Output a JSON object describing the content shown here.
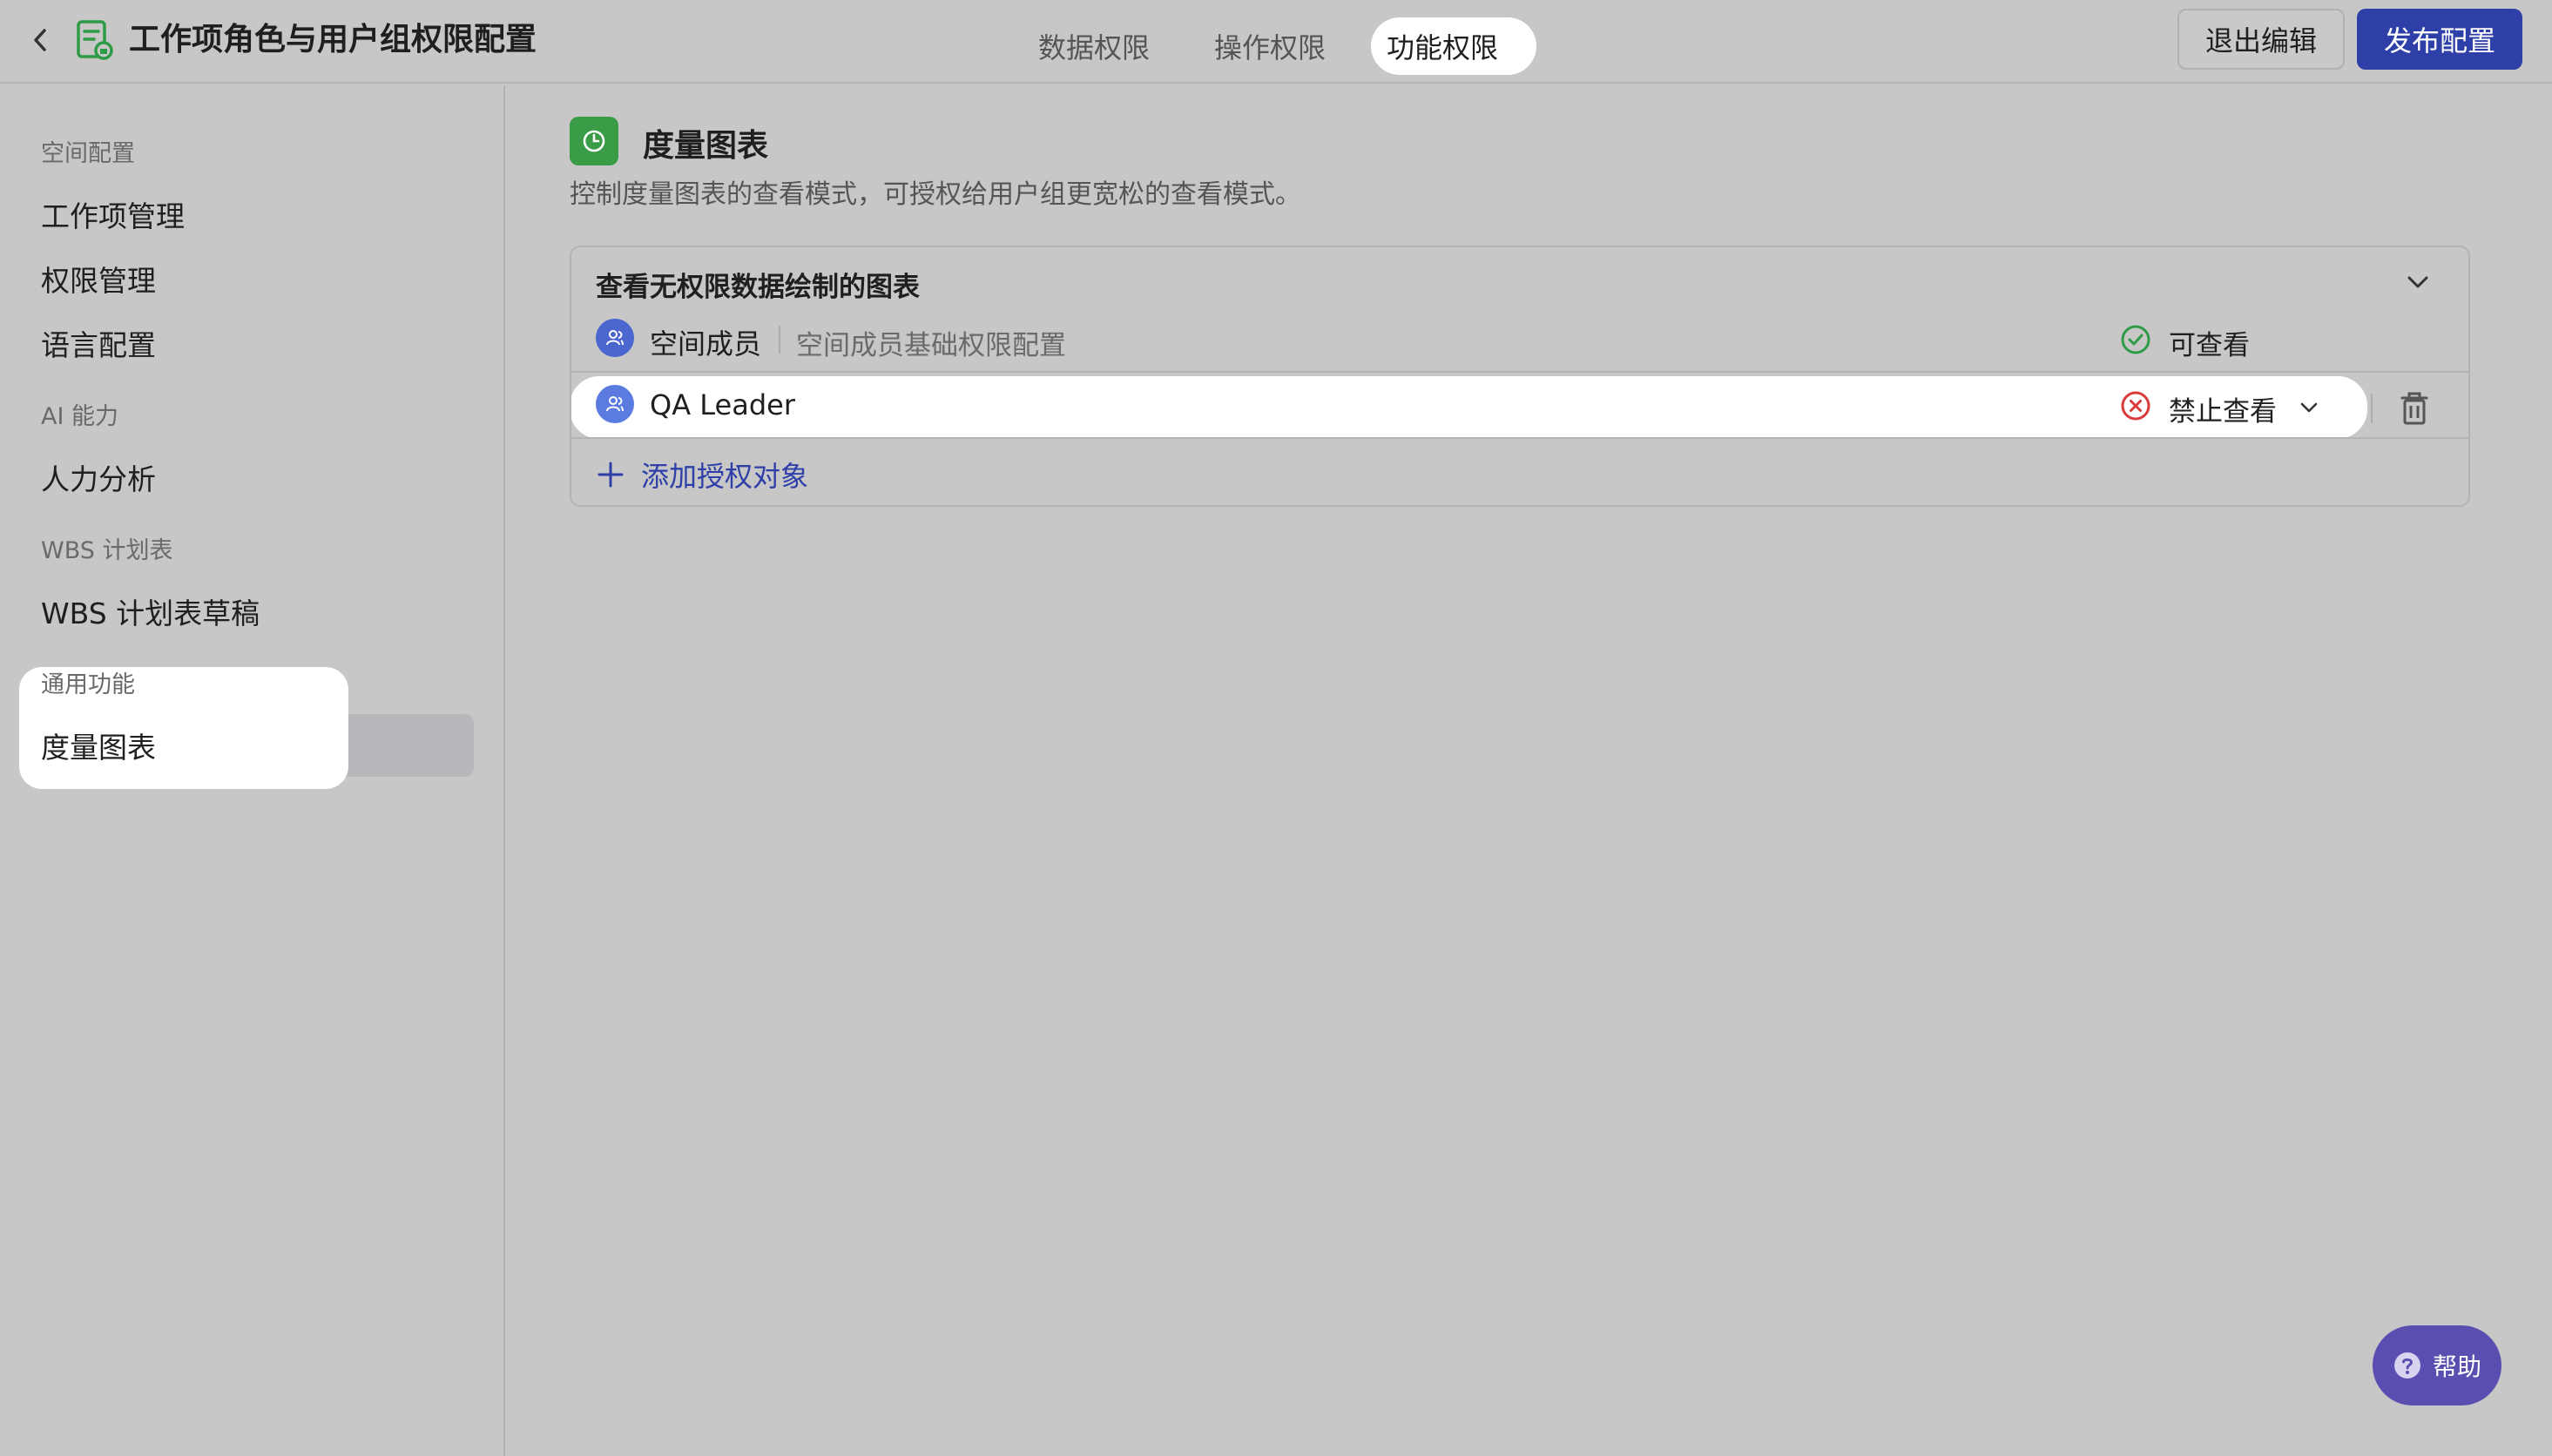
{
  "header": {
    "title": "工作项角色与用户组权限配置",
    "tabs": [
      {
        "label": "数据权限",
        "active": false
      },
      {
        "label": "操作权限",
        "active": false
      },
      {
        "label": "功能权限",
        "active": true
      }
    ],
    "exit_label": "退出编辑",
    "publish_label": "发布配置"
  },
  "sidebar": {
    "sections": [
      {
        "label": "空间配置",
        "items": [
          "工作项管理",
          "权限管理",
          "语言配置"
        ]
      },
      {
        "label": "AI 能力",
        "items": [
          "人力分析"
        ]
      },
      {
        "label": "WBS 计划表",
        "items": [
          "WBS 计划表草稿"
        ]
      },
      {
        "label": "通用功能",
        "items": [
          "度量图表"
        ]
      }
    ],
    "active_item": "度量图表"
  },
  "main": {
    "title": "度量图表",
    "description": "控制度量图表的查看模式，可授权给用户组更宽松的查看模式。",
    "card": {
      "title": "查看无权限数据绘制的图表",
      "rows": [
        {
          "name": "空间成员",
          "sub": "空间成员基础权限配置",
          "permission": "可查看",
          "status": "allowed"
        },
        {
          "name": "QA Leader",
          "sub": "",
          "permission": "禁止查看",
          "status": "denied"
        }
      ],
      "add_label": "添加授权对象"
    }
  },
  "help_label": "帮助",
  "colors": {
    "primary": "#2e3fa8",
    "allowed": "#2e9b47",
    "denied": "#d93a3a",
    "feature_icon": "#3b9c47"
  }
}
